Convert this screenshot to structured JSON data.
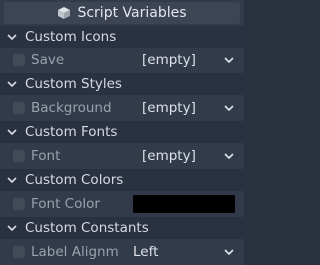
{
  "panel": {
    "title": "Script Variables",
    "title_icon": "cube-icon"
  },
  "sections": {
    "icons": {
      "header": "Custom Icons",
      "row_label": "Save",
      "row_value": "[empty]"
    },
    "styles": {
      "header": "Custom Styles",
      "row_label": "Background",
      "row_value": "[empty]"
    },
    "fonts": {
      "header": "Custom Fonts",
      "row_label": "Font",
      "row_value": "[empty]"
    },
    "colors": {
      "header": "Custom Colors",
      "row_label": "Font Color",
      "swatch_color": "#000000"
    },
    "constants": {
      "header": "Custom Constants",
      "row_label": "Label Alignm",
      "row_value": "Left"
    }
  }
}
